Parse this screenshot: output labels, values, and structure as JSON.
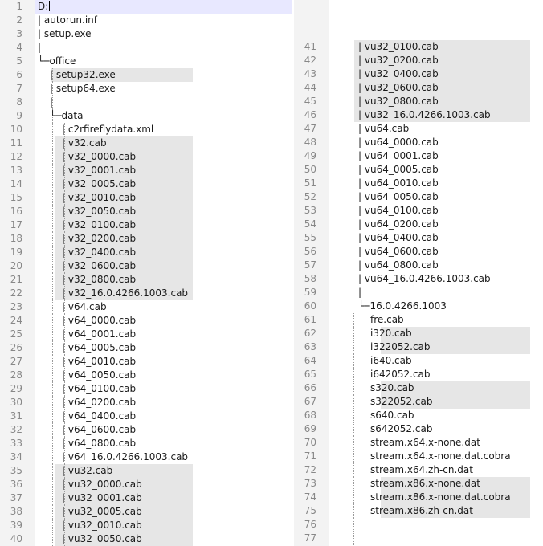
{
  "editor": {
    "left_lines": [
      {
        "n": "1",
        "depth": 0,
        "prefix": "",
        "text": "D:"
      },
      {
        "n": "2",
        "depth": 0,
        "prefix": "| ",
        "text": "autorun.inf"
      },
      {
        "n": "3",
        "depth": 0,
        "prefix": "| ",
        "text": "setup.exe"
      },
      {
        "n": "4",
        "depth": 0,
        "prefix": "|",
        "text": ""
      },
      {
        "n": "5",
        "depth": 0,
        "prefix": "└─",
        "text": "office"
      },
      {
        "n": "6",
        "depth": 1,
        "prefix": "| ",
        "text": "setup32.exe"
      },
      {
        "n": "7",
        "depth": 1,
        "prefix": "| ",
        "text": "setup64.exe"
      },
      {
        "n": "8",
        "depth": 1,
        "prefix": "|",
        "text": ""
      },
      {
        "n": "9",
        "depth": 1,
        "prefix": "└─",
        "text": "data"
      },
      {
        "n": "10",
        "depth": 2,
        "prefix": "| ",
        "text": "c2rfireflydata.xml"
      },
      {
        "n": "11",
        "depth": 2,
        "prefix": "| ",
        "text": "v32.cab"
      },
      {
        "n": "12",
        "depth": 2,
        "prefix": "| ",
        "text": "v32_0000.cab"
      },
      {
        "n": "13",
        "depth": 2,
        "prefix": "| ",
        "text": "v32_0001.cab"
      },
      {
        "n": "14",
        "depth": 2,
        "prefix": "| ",
        "text": "v32_0005.cab"
      },
      {
        "n": "15",
        "depth": 2,
        "prefix": "| ",
        "text": "v32_0010.cab"
      },
      {
        "n": "16",
        "depth": 2,
        "prefix": "| ",
        "text": "v32_0050.cab"
      },
      {
        "n": "17",
        "depth": 2,
        "prefix": "| ",
        "text": "v32_0100.cab"
      },
      {
        "n": "18",
        "depth": 2,
        "prefix": "| ",
        "text": "v32_0200.cab"
      },
      {
        "n": "19",
        "depth": 2,
        "prefix": "| ",
        "text": "v32_0400.cab"
      },
      {
        "n": "20",
        "depth": 2,
        "prefix": "| ",
        "text": "v32_0600.cab"
      },
      {
        "n": "21",
        "depth": 2,
        "prefix": "| ",
        "text": "v32_0800.cab"
      },
      {
        "n": "22",
        "depth": 2,
        "prefix": "| ",
        "text": "v32_16.0.4266.1003.cab"
      },
      {
        "n": "23",
        "depth": 2,
        "prefix": "| ",
        "text": "v64.cab"
      },
      {
        "n": "24",
        "depth": 2,
        "prefix": "| ",
        "text": "v64_0000.cab"
      },
      {
        "n": "25",
        "depth": 2,
        "prefix": "| ",
        "text": "v64_0001.cab"
      },
      {
        "n": "26",
        "depth": 2,
        "prefix": "| ",
        "text": "v64_0005.cab"
      },
      {
        "n": "27",
        "depth": 2,
        "prefix": "| ",
        "text": "v64_0010.cab"
      },
      {
        "n": "28",
        "depth": 2,
        "prefix": "| ",
        "text": "v64_0050.cab"
      },
      {
        "n": "29",
        "depth": 2,
        "prefix": "| ",
        "text": "v64_0100.cab"
      },
      {
        "n": "30",
        "depth": 2,
        "prefix": "| ",
        "text": "v64_0200.cab"
      },
      {
        "n": "31",
        "depth": 2,
        "prefix": "| ",
        "text": "v64_0400.cab"
      },
      {
        "n": "32",
        "depth": 2,
        "prefix": "| ",
        "text": "v64_0600.cab"
      },
      {
        "n": "33",
        "depth": 2,
        "prefix": "| ",
        "text": "v64_0800.cab"
      },
      {
        "n": "34",
        "depth": 2,
        "prefix": "| ",
        "text": "v64_16.0.4266.1003.cab"
      },
      {
        "n": "35",
        "depth": 2,
        "prefix": "| ",
        "text": "vu32.cab"
      },
      {
        "n": "36",
        "depth": 2,
        "prefix": "| ",
        "text": "vu32_0000.cab"
      },
      {
        "n": "37",
        "depth": 2,
        "prefix": "| ",
        "text": "vu32_0001.cab"
      },
      {
        "n": "38",
        "depth": 2,
        "prefix": "| ",
        "text": "vu32_0005.cab"
      },
      {
        "n": "39",
        "depth": 2,
        "prefix": "| ",
        "text": "vu32_0010.cab"
      },
      {
        "n": "40",
        "depth": 2,
        "prefix": "| ",
        "text": "vu32_0050.cab"
      }
    ],
    "right_lines": [
      {
        "n": "41",
        "depth": 0,
        "prefix": "| ",
        "text": "vu32_0100.cab"
      },
      {
        "n": "42",
        "depth": 0,
        "prefix": "| ",
        "text": "vu32_0200.cab"
      },
      {
        "n": "43",
        "depth": 0,
        "prefix": "| ",
        "text": "vu32_0400.cab"
      },
      {
        "n": "44",
        "depth": 0,
        "prefix": "| ",
        "text": "vu32_0600.cab"
      },
      {
        "n": "45",
        "depth": 0,
        "prefix": "| ",
        "text": "vu32_0800.cab"
      },
      {
        "n": "46",
        "depth": 0,
        "prefix": "| ",
        "text": "vu32_16.0.4266.1003.cab"
      },
      {
        "n": "47",
        "depth": 0,
        "prefix": "| ",
        "text": "vu64.cab"
      },
      {
        "n": "48",
        "depth": 0,
        "prefix": "| ",
        "text": "vu64_0000.cab"
      },
      {
        "n": "49",
        "depth": 0,
        "prefix": "| ",
        "text": "vu64_0001.cab"
      },
      {
        "n": "50",
        "depth": 0,
        "prefix": "| ",
        "text": "vu64_0005.cab"
      },
      {
        "n": "51",
        "depth": 0,
        "prefix": "| ",
        "text": "vu64_0010.cab"
      },
      {
        "n": "52",
        "depth": 0,
        "prefix": "| ",
        "text": "vu64_0050.cab"
      },
      {
        "n": "53",
        "depth": 0,
        "prefix": "| ",
        "text": "vu64_0100.cab"
      },
      {
        "n": "54",
        "depth": 0,
        "prefix": "| ",
        "text": "vu64_0200.cab"
      },
      {
        "n": "55",
        "depth": 0,
        "prefix": "| ",
        "text": "vu64_0400.cab"
      },
      {
        "n": "56",
        "depth": 0,
        "prefix": "| ",
        "text": "vu64_0600.cab"
      },
      {
        "n": "57",
        "depth": 0,
        "prefix": "| ",
        "text": "vu64_0800.cab"
      },
      {
        "n": "58",
        "depth": 0,
        "prefix": "| ",
        "text": "vu64_16.0.4266.1003.cab"
      },
      {
        "n": "59",
        "depth": 0,
        "prefix": "|",
        "text": ""
      },
      {
        "n": "60",
        "depth": 0,
        "prefix": "└─",
        "text": "16.0.4266.1003"
      },
      {
        "n": "61",
        "depth": 1,
        "prefix": "",
        "text": "fre.cab"
      },
      {
        "n": "62",
        "depth": 1,
        "prefix": "",
        "text": "i320.cab"
      },
      {
        "n": "63",
        "depth": 1,
        "prefix": "",
        "text": "i322052.cab"
      },
      {
        "n": "64",
        "depth": 1,
        "prefix": "",
        "text": "i640.cab"
      },
      {
        "n": "65",
        "depth": 1,
        "prefix": "",
        "text": "i642052.cab"
      },
      {
        "n": "66",
        "depth": 1,
        "prefix": "",
        "text": "s320.cab"
      },
      {
        "n": "67",
        "depth": 1,
        "prefix": "",
        "text": "s322052.cab"
      },
      {
        "n": "68",
        "depth": 1,
        "prefix": "",
        "text": "s640.cab"
      },
      {
        "n": "69",
        "depth": 1,
        "prefix": "",
        "text": "s642052.cab"
      },
      {
        "n": "70",
        "depth": 1,
        "prefix": "",
        "text": "stream.x64.x-none.dat"
      },
      {
        "n": "71",
        "depth": 1,
        "prefix": "",
        "text": "stream.x64.x-none.dat.cobra"
      },
      {
        "n": "72",
        "depth": 1,
        "prefix": "",
        "text": "stream.x64.zh-cn.dat"
      },
      {
        "n": "73",
        "depth": 1,
        "prefix": "",
        "text": "stream.x86.x-none.dat"
      },
      {
        "n": "74",
        "depth": 1,
        "prefix": "",
        "text": "stream.x86.x-none.dat.cobra"
      },
      {
        "n": "75",
        "depth": 1,
        "prefix": "",
        "text": "stream.x86.zh-cn.dat"
      },
      {
        "n": "76",
        "depth": 1,
        "prefix": "",
        "text": ""
      },
      {
        "n": "77",
        "depth": 1,
        "prefix": "",
        "text": ""
      }
    ],
    "colors": {
      "gutter": "#f3f3f3",
      "line_number": "#888888",
      "current_line": "#e8e8ff",
      "highlight": "#e6e6e6",
      "text": "#1a1a1a"
    }
  }
}
